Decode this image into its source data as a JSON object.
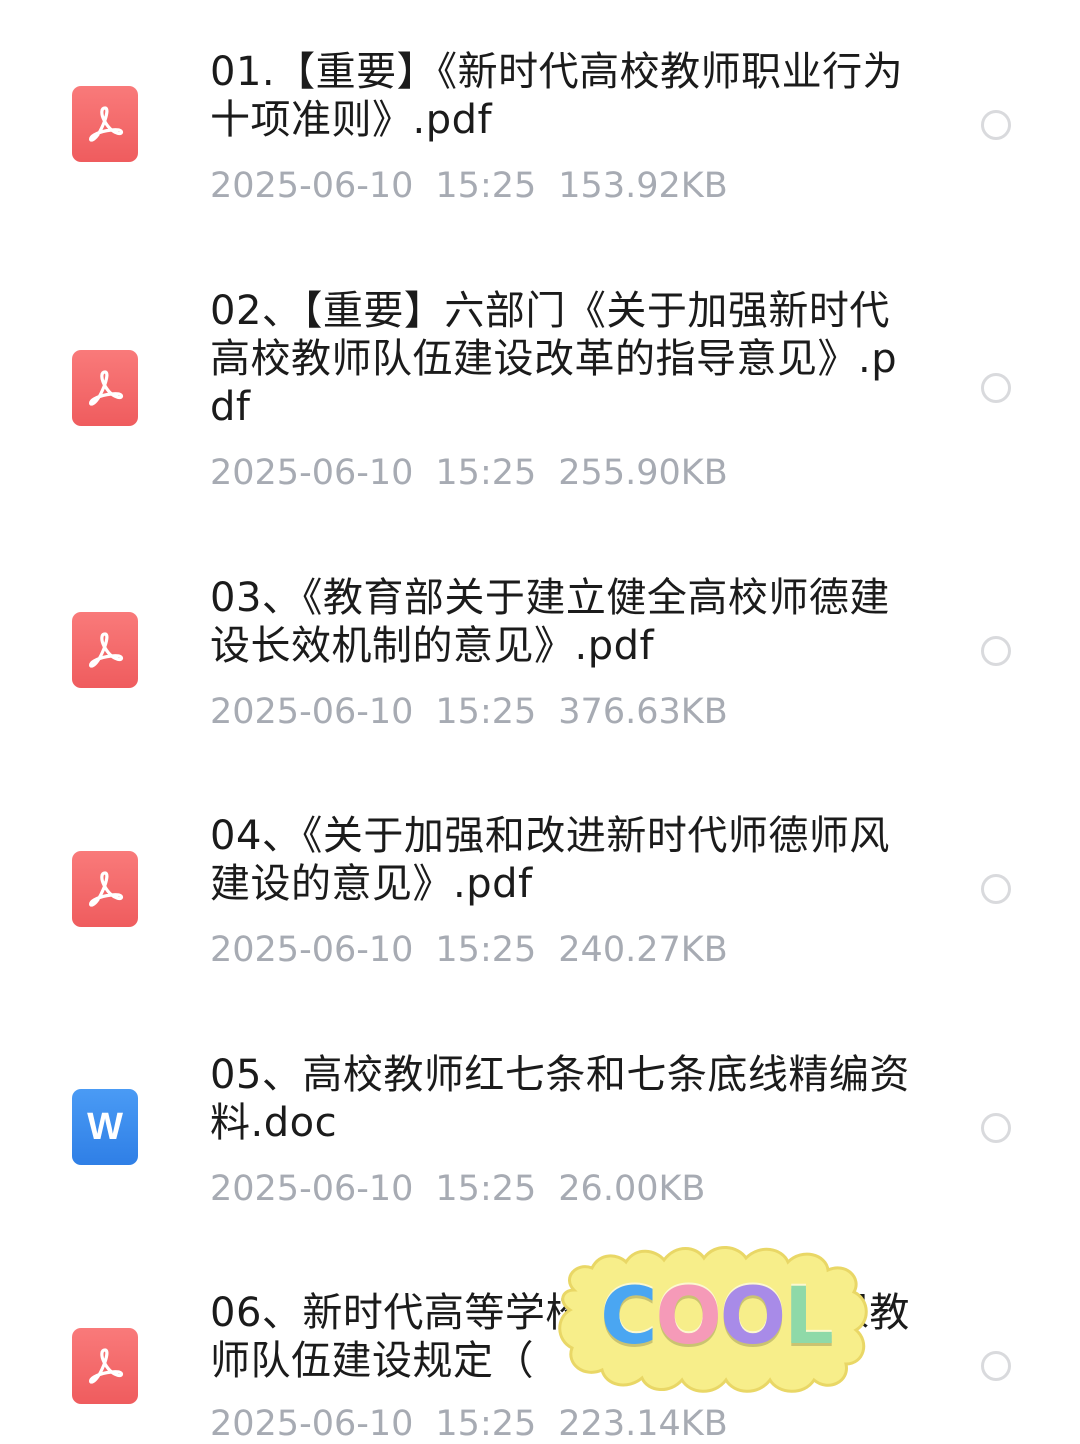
{
  "files": [
    {
      "name": "01.【重要】《新时代高校教师职业行为十项准则》.pdf",
      "type": "pdf",
      "date": "2025-06-10",
      "time": "15:25",
      "size": "153.92KB"
    },
    {
      "name": "02、【重要】六部门《关于加强新时代高校教师队伍建设改革的指导意见》.pdf",
      "type": "pdf",
      "date": "2025-06-10",
      "time": "15:25",
      "size": "255.90KB"
    },
    {
      "name": "03、《教育部关于建立健全高校师德建设长效机制的意见》.pdf",
      "type": "pdf",
      "date": "2025-06-10",
      "time": "15:25",
      "size": "376.63KB"
    },
    {
      "name": "04、《关于加强和改进新时代师德师风建设的意见》.pdf",
      "type": "pdf",
      "date": "2025-06-10",
      "time": "15:25",
      "size": "240.27KB"
    },
    {
      "name": "05、高校教师红七条和七条底线精编资料.doc",
      "type": "doc",
      "icon_letter": "W",
      "date": "2025-06-10",
      "time": "15:25",
      "size": "26.00KB"
    },
    {
      "name": "06、新时代高等学校思想政治理论课教师队伍建设规定（",
      "type": "pdf",
      "date": "2025-06-10",
      "time": "15:25",
      "size": "223.14KB"
    }
  ],
  "sticker": {
    "text": "COOL",
    "letter_colors": [
      "#4aa6f2",
      "#f59ab8",
      "#a88be8",
      "#8fd9a8"
    ],
    "background_color": "#f7ee8a"
  },
  "colors": {
    "pdf_icon": "#f06a6c",
    "doc_icon": "#3a8cf0",
    "title_text": "#1b1b1b",
    "meta_text": "#a7abb3"
  }
}
